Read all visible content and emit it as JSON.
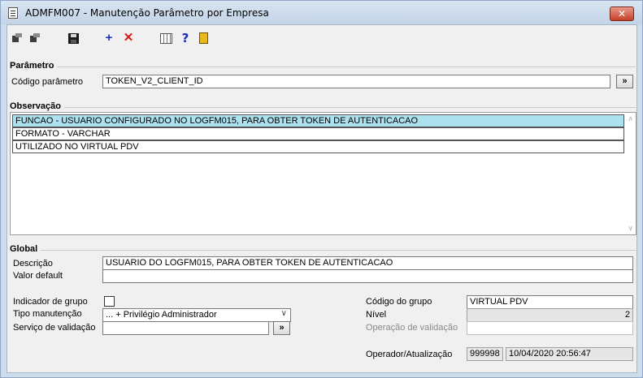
{
  "window": {
    "title": "ADMFM007 - Manutenção Parâmetro por Empresa",
    "close_label": "✕"
  },
  "toolbar": {
    "add_label": "+",
    "delete_label": "✕",
    "help_label": "?"
  },
  "parametro": {
    "section_title": "Parâmetro",
    "codigo_label": "Código parâmetro",
    "codigo_value": "TOKEN_V2_CLIENT_ID",
    "lookup_label": "»"
  },
  "observacao": {
    "section_title": "Observação",
    "lines": [
      "FUNCAO - USUARIO CONFIGURADO NO LOGFM015, PARA OBTER TOKEN DE AUTENTICACAO",
      "FORMATO - VARCHAR",
      "UTILIZADO NO VIRTUAL PDV"
    ]
  },
  "global": {
    "section_title": "Global",
    "descricao_label": "Descrição",
    "descricao_value": "USUARIO DO LOGFM015, PARA OBTER TOKEN DE AUTENTICACAO",
    "valor_default_label": "Valor default",
    "valor_default_value": "",
    "indicador_grupo_label": "Indicador de grupo",
    "tipo_manutencao_label": "Tipo manutenção",
    "tipo_manutencao_value": "... + Privilégio Administrador",
    "servico_validacao_label": "Serviço de validação",
    "servico_validacao_value": "",
    "servico_lookup_label": "»",
    "codigo_grupo_label": "Código do grupo",
    "codigo_grupo_value": "VIRTUAL PDV",
    "nivel_label": "Nível",
    "nivel_value": "2",
    "operacao_validacao_label": "Operação de validação",
    "operacao_validacao_value": "",
    "operador_label": "Operador/Atualização",
    "operador_value": "999998",
    "atualizacao_value": "10/04/2020 20:56:47"
  }
}
